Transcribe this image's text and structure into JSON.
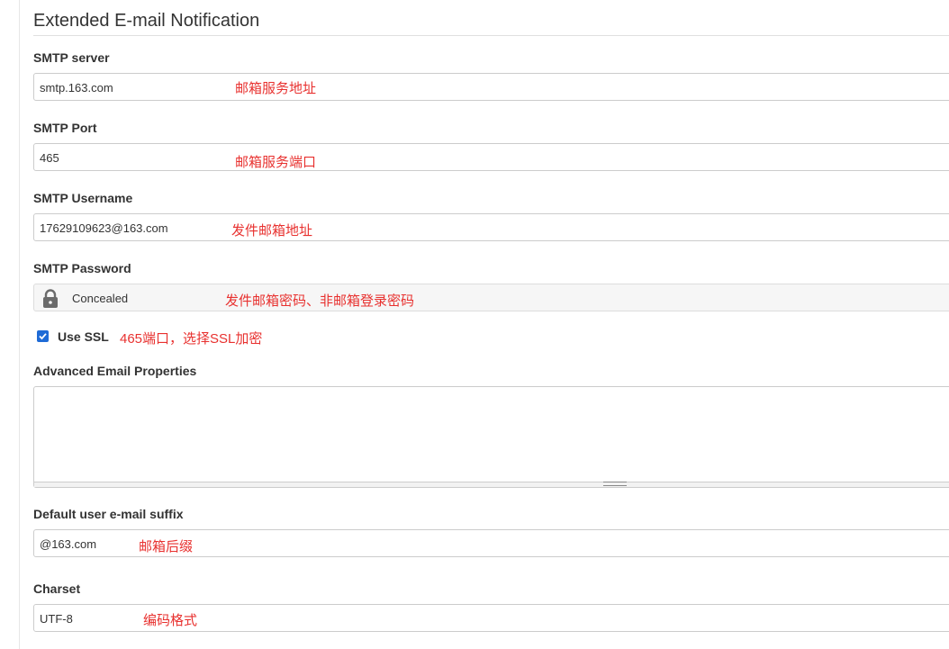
{
  "section": {
    "title": "Extended E-mail Notification"
  },
  "smtp_server": {
    "label": "SMTP server",
    "value": "smtp.163.com",
    "note": "邮箱服务地址"
  },
  "smtp_port": {
    "label": "SMTP Port",
    "value": "465",
    "note": "邮箱服务端口"
  },
  "smtp_username": {
    "label": "SMTP Username",
    "value": "17629109623@163.com",
    "note": "发件邮箱地址"
  },
  "smtp_password": {
    "label": "SMTP Password",
    "value": "Concealed",
    "note": "发件邮箱密码、非邮箱登录密码",
    "icon": "lock-icon"
  },
  "use_ssl": {
    "label": "Use SSL",
    "checked": true,
    "note": "465端口，选择SSL加密"
  },
  "advanced_props": {
    "label": "Advanced Email Properties",
    "value": ""
  },
  "default_suffix": {
    "label": "Default user e-mail suffix",
    "value": "@163.com",
    "note": "邮箱后缀"
  },
  "charset": {
    "label": "Charset",
    "value": "UTF-8",
    "note": "编码格式"
  },
  "colors": {
    "annotation": "#e8312f",
    "checkbox": "#1f6bd6"
  }
}
